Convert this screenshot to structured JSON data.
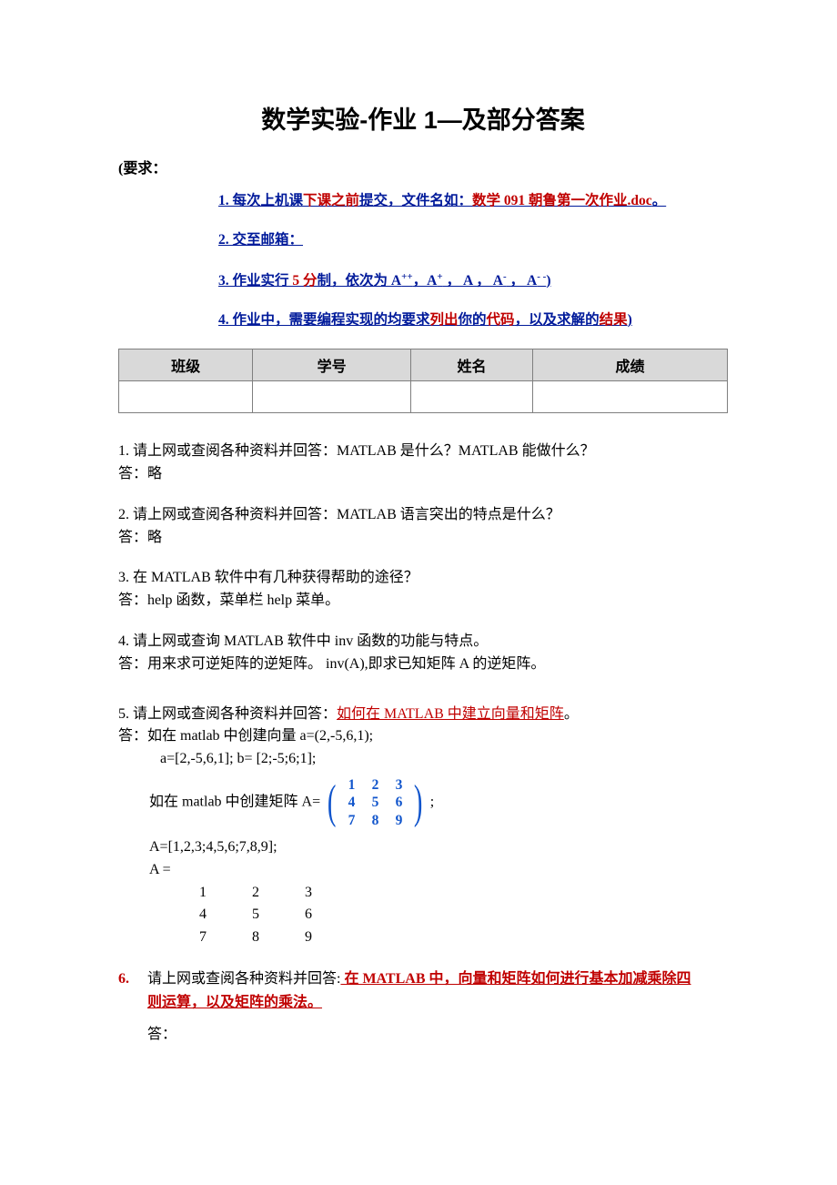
{
  "title": "数学实验-作业 1—及部分答案",
  "req_label": "(要求：",
  "req1_a": "1. 每次上机课",
  "req1_b": "下课之前",
  "req1_c": "提交，文件名如：",
  "req1_d": "数学 091 朝鲁第一次作业.doc",
  "req1_e": "。",
  "req2": "2. 交至邮箱：",
  "req3_a": "3. 作业实行",
  "req3_b": " 5 分",
  "req3_c": "制，依次为 A",
  "req3_d": "，A",
  "req3_e": " ， A  ， A",
  "req3_f": " ， A",
  "req3_g": ")",
  "sup_pp": "++",
  "sup_p": "+",
  "sup_m": "-",
  "sup_mm": "- -",
  "req4_a": "4. 作业中，需要编程实现的均要求",
  "req4_b": "列出",
  "req4_c": "你的",
  "req4_d": "代码",
  "req4_e": "，以及求解的",
  "req4_f": "结果",
  "req4_g": ")",
  "th1": "班级",
  "th2": "学号",
  "th3": "姓名",
  "th4": "成绩",
  "q1": "1. 请上网或查阅各种资料并回答：MATLAB 是什么？MATLAB 能做什么？",
  "a1": "答：略",
  "q2": "2. 请上网或查阅各种资料并回答：MATLAB 语言突出的特点是什么？",
  "a2": "答：略",
  "q3": "3. 在 MATLAB 软件中有几种获得帮助的途径？",
  "a3": "答：help 函数，菜单栏 help 菜单。",
  "q4": "4. 请上网或查询 MATLAB 软件中 inv 函数的功能与特点。",
  "a4": "答：用来求可逆矩阵的逆矩阵。 inv(A),即求已知矩阵 A 的逆矩阵。",
  "q5_a": "5. 请上网或查阅各种资料并回答：",
  "q5_b": "如何在 MATLAB 中建立向量和矩阵",
  "q5_c": "。",
  "a5_l1": "答：如在 matlab 中创建向量 a=(2,-5,6,1);",
  "a5_l2": "a=[2,-5,6,1]; b= [2;-5;6;1];",
  "a5_l3_pre": "如在 matlab 中创建矩阵 A=",
  "a5_l3_post": ";",
  "m_r1c1": "1",
  "m_r1c2": "2",
  "m_r1c3": "3",
  "m_r2c1": "4",
  "m_r2c2": "5",
  "m_r2c3": "6",
  "m_r3c1": "7",
  "m_r3c2": "8",
  "m_r3c3": "9",
  "a5_l4": "A=[1,2,3;4,5,6;7,8,9];",
  "a5_l5": "A =",
  "pm_r1c1": "1",
  "pm_r1c2": "2",
  "pm_r1c3": "3",
  "pm_r2c1": "4",
  "pm_r2c2": "5",
  "pm_r2c3": "6",
  "pm_r3c1": "7",
  "pm_r3c2": "8",
  "pm_r3c3": "9",
  "q6_num": "6.",
  "q6_lead": " 请上网或查阅各种资料并回答:",
  "q6_red1": " 在 MATLAB 中，向量和矩阵如何进行基本加减乘除四",
  "q6_red2": "则运算，以及矩阵的乘法。",
  "q6_ans": "答："
}
